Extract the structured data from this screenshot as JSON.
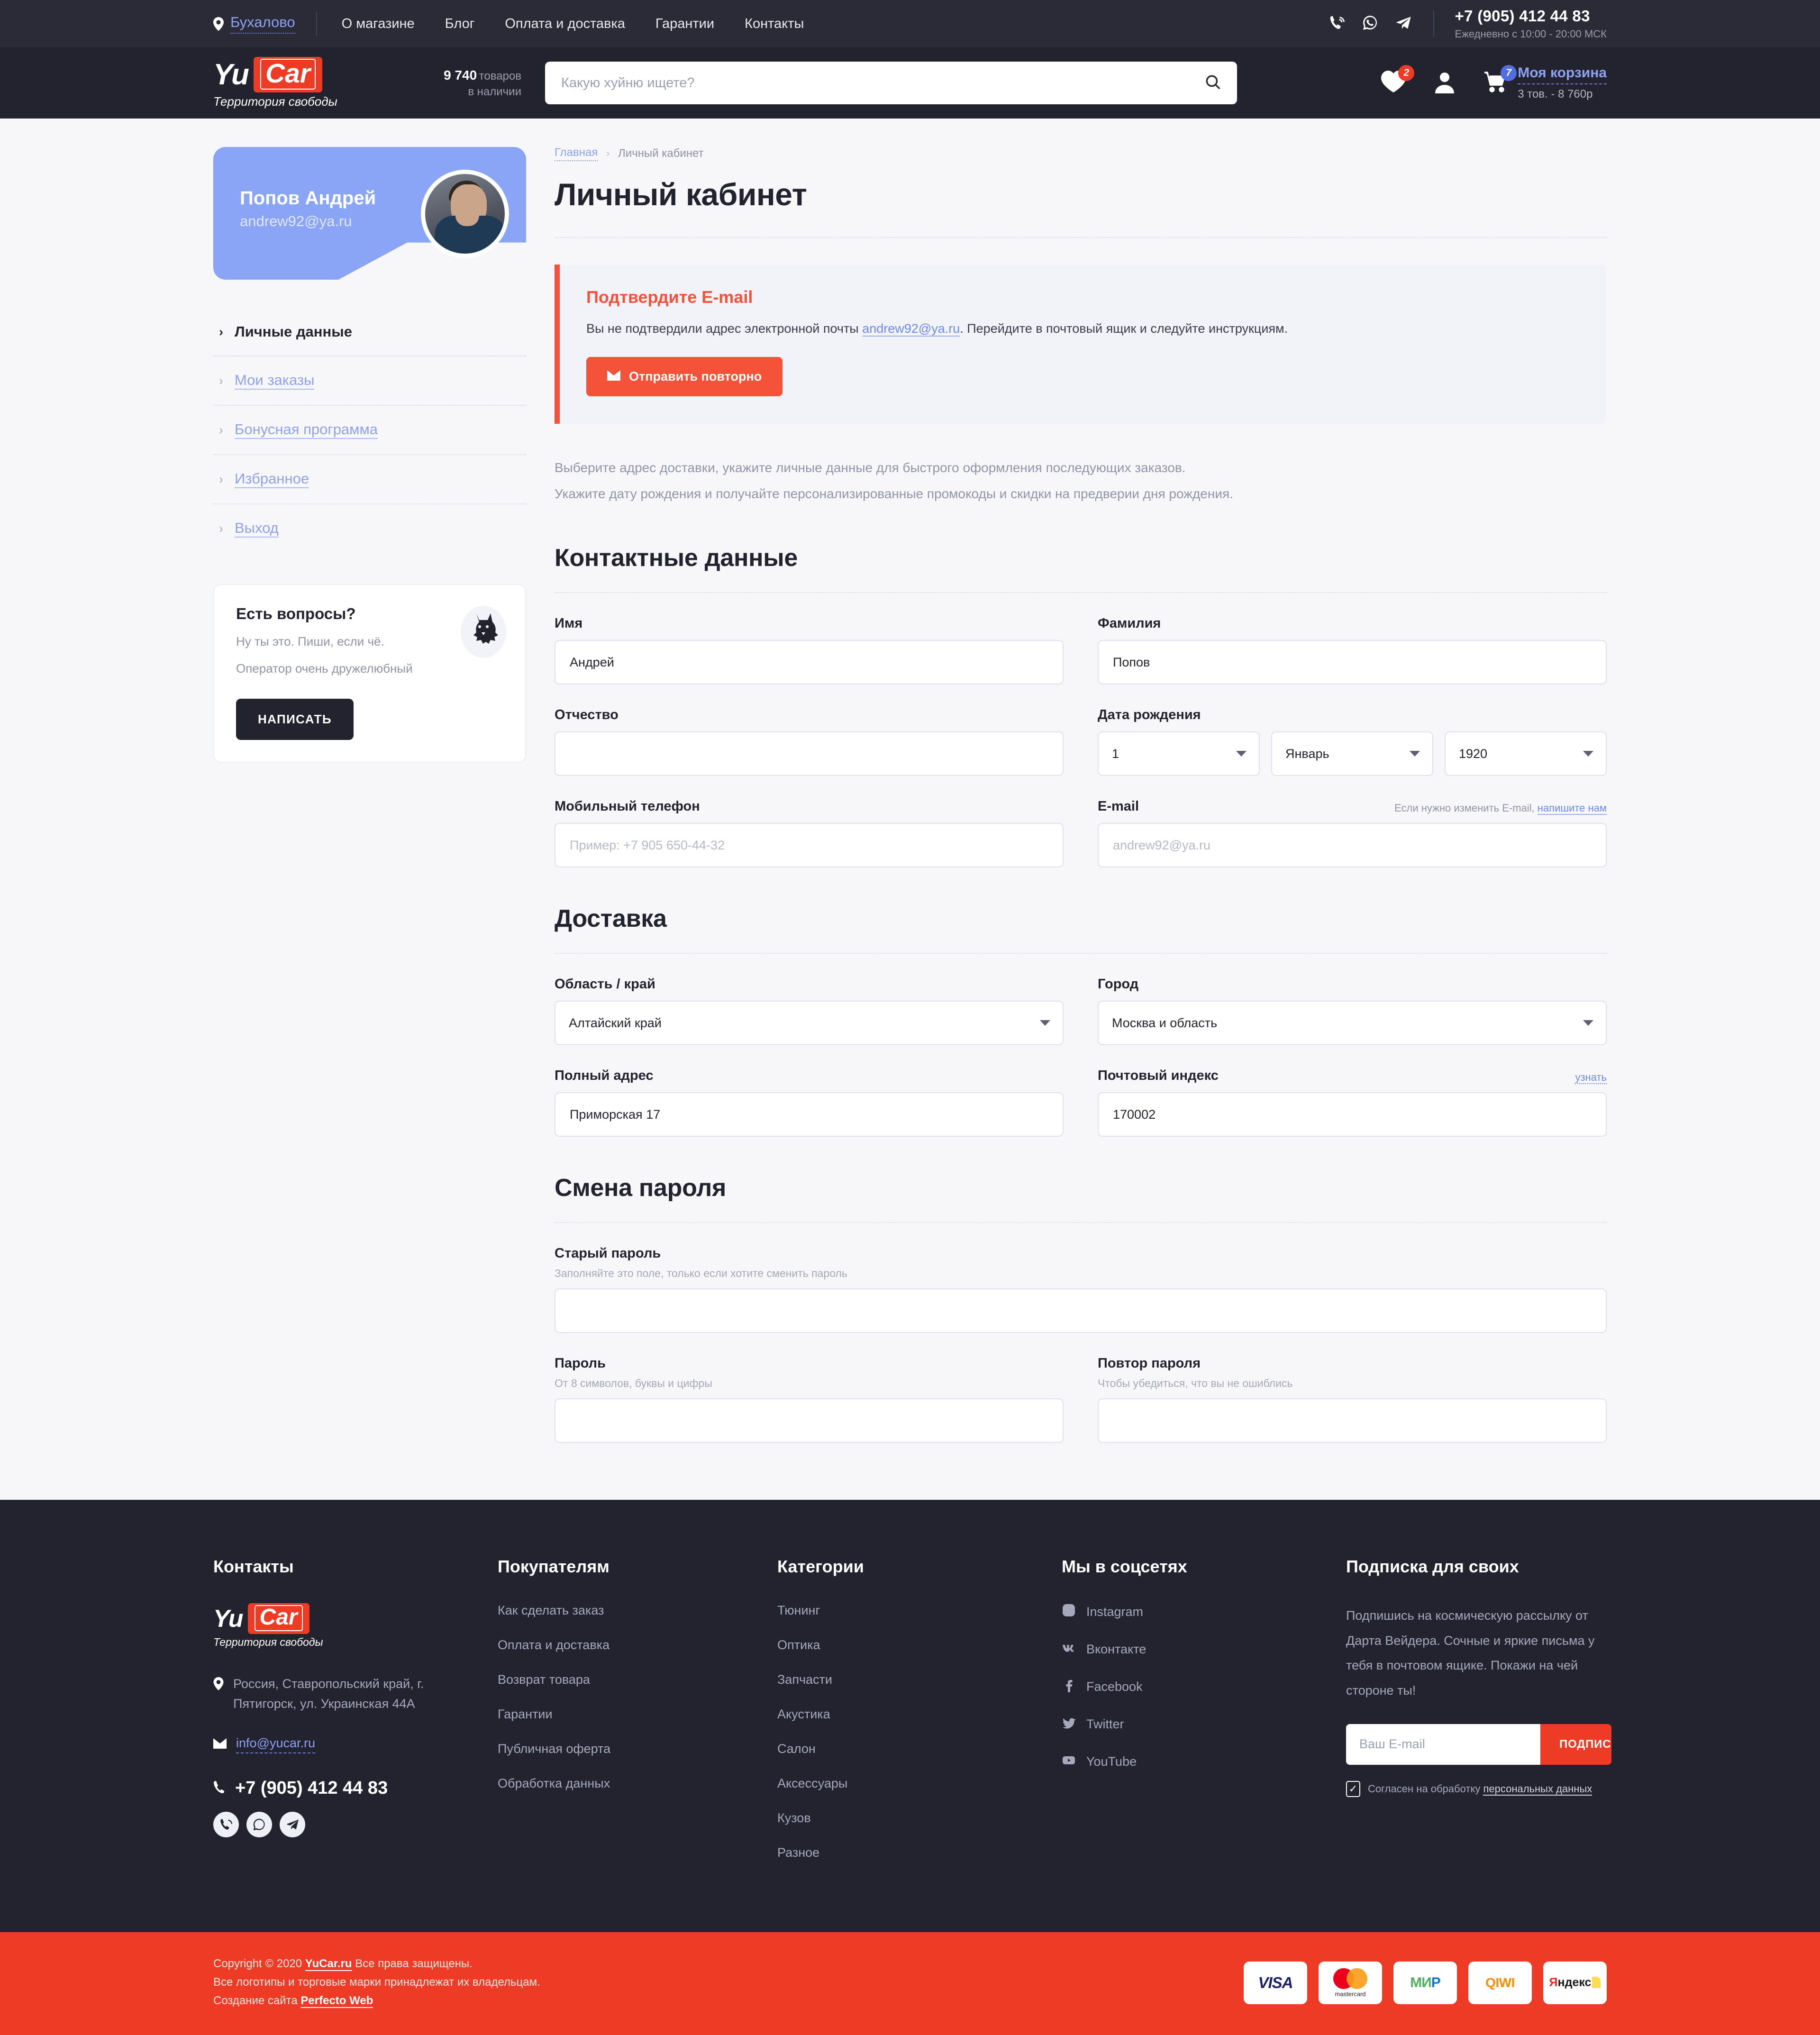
{
  "topbar": {
    "geo_label": "Бухалово",
    "nav": [
      {
        "label": "О магазине"
      },
      {
        "label": "Блог"
      },
      {
        "label": "Оплата и доставка"
      },
      {
        "label": "Гарантии"
      },
      {
        "label": "Контакты"
      }
    ],
    "phone": "+7 (905) 412 44 83",
    "hours": "Ежедневно с 10:00 - 20:00 МСК",
    "icons": [
      "viber-icon",
      "whatsapp-icon",
      "telegram-icon"
    ]
  },
  "header": {
    "logo_yu": "Yu",
    "logo_car": "Car",
    "logo_tagline": "Территория свободы",
    "goods_count": "9 740",
    "goods_word": "товаров",
    "goods_stock": "в наличии",
    "search_placeholder": "Какую хуйню ищете?",
    "search_value": "",
    "favorites_badge": "2",
    "cart_badge": "7",
    "cart_title": "Моя корзина",
    "cart_sub": "3 тов. - 8 760р"
  },
  "sidebar": {
    "profile": {
      "name": "Попов Андрей",
      "email": "andrew92@ya.ru"
    },
    "menu": [
      {
        "label": "Личные данные",
        "active": true
      },
      {
        "label": "Мои заказы",
        "active": false
      },
      {
        "label": "Бонусная программа",
        "active": false
      },
      {
        "label": "Избранное",
        "active": false
      },
      {
        "label": "Выход",
        "active": false
      }
    ],
    "questions": {
      "title": "Есть вопросы?",
      "line1": "Ну ты это. Пиши, если чё.",
      "line2": "Оператор очень дружелюбный",
      "button": "НАПИСАТЬ"
    }
  },
  "main": {
    "breadcrumb_home": "Главная",
    "breadcrumb_current": "Личный кабинет",
    "title": "Личный кабинет",
    "alert": {
      "title": "Подтвердите E-mail",
      "text_before": "Вы не подтвердили адрес электронной почты ",
      "email": "andrew92@ya.ru",
      "text_after": ". Перейдите в почтовый ящик и следуйте инструкциям.",
      "button": "Отправить повторно"
    },
    "lead_1": "Выберите адрес доставки, укажите личные данные для быстрого оформления последующих заказов.",
    "lead_2": "Укажите дату рождения и получайте персонализированные промокоды и скидки на предверии дня рождения.",
    "contacts": {
      "heading": "Контактные данные",
      "first_name_label": "Имя",
      "first_name_value": "Андрей",
      "last_name_label": "Фамилия",
      "last_name_value": "Попов",
      "patronymic_label": "Отчество",
      "patronymic_value": "",
      "dob_label": "Дата рождения",
      "dob_day": "1",
      "dob_month": "Январь",
      "dob_year": "1920",
      "phone_label": "Мобильный телефон",
      "phone_placeholder": "Пример: +7 905 650-44-32",
      "phone_value": "",
      "email_label": "E-mail",
      "email_note": "Если нужно изменить E-mail, ",
      "email_note_link": "напишите нам",
      "email_placeholder": "andrew92@ya.ru",
      "email_value": ""
    },
    "delivery": {
      "heading": "Доставка",
      "region_label": "Область / край",
      "region_value": "Алтайский край",
      "city_label": "Город",
      "city_value": "Москва и область",
      "address_label": "Полный адрес",
      "address_value": "Приморская 17",
      "zip_label": "Почтовый индекс",
      "zip_link": "узнать",
      "zip_value": "170002"
    },
    "password": {
      "heading": "Смена пароля",
      "old_label": "Старый пароль",
      "old_hint": "Заполняйте это поле, только если хотите сменить пароль",
      "old_value": "",
      "new_label": "Пароль",
      "new_hint": "От 8 символов, буквы и цифры",
      "new_value": "",
      "repeat_label": "Повтор пароля",
      "repeat_hint": "Чтобы убедиться, что вы не ошиблись",
      "repeat_value": ""
    }
  },
  "footer": {
    "contacts_heading": "Контакты",
    "logo_yu": "Yu",
    "logo_car": "Car",
    "logo_tagline": "Территория свободы",
    "address": "Россия, Ставропольский край, г. Пятигорск, ул. Украинская 44А",
    "email": "info@yucar.ru",
    "phone": "+7 (905) 412 44 83",
    "buyers_heading": "Покупателям",
    "buyers": [
      {
        "label": "Как сделать заказ"
      },
      {
        "label": "Оплата и доставка"
      },
      {
        "label": "Возврат товара"
      },
      {
        "label": "Гарантии"
      },
      {
        "label": "Публичная оферта"
      },
      {
        "label": "Обработка данных"
      }
    ],
    "categories_heading": "Категории",
    "categories": [
      {
        "label": "Тюнинг"
      },
      {
        "label": "Оптика"
      },
      {
        "label": "Запчасти"
      },
      {
        "label": "Акустика"
      },
      {
        "label": "Салон"
      },
      {
        "label": "Аксессуары"
      },
      {
        "label": "Кузов"
      },
      {
        "label": "Разное"
      }
    ],
    "social_heading": "Мы в соцсетях",
    "socials": [
      {
        "label": "Instagram",
        "icon": "instagram-icon"
      },
      {
        "label": "Вконтакте",
        "icon": "vk-icon"
      },
      {
        "label": "Facebook",
        "icon": "facebook-icon"
      },
      {
        "label": "Twitter",
        "icon": "twitter-icon"
      },
      {
        "label": "YouTube",
        "icon": "youtube-icon"
      }
    ],
    "subscribe_heading": "Подписка для своих",
    "subscribe_text": "Подпишись на космическую рассылку от Дарта Вейдера. Сочные и яркие письма у тебя в почтовом ящике. Покажи на чей стороне ты!",
    "subscribe_placeholder": "Ваш E-mail",
    "subscribe_value": "",
    "subscribe_button": "ПОДПИСАТЬСЯ",
    "agree_text": "Согласен на обработку ",
    "agree_link": "персональных данных",
    "copyright_line1_a": "Copyright © 2020 ",
    "copyright_line1_link": "YuCar.ru",
    "copyright_line1_b": " Все права защищены.",
    "copyright_line2": "Все логотипы и торговые марки принадлежат их владельцам.",
    "copyright_line3_a": "Создание сайта ",
    "copyright_line3_link": "Perfecto Web",
    "payments": [
      "VISA",
      "mastercard",
      "МИР",
      "QIWI",
      "Яндекс"
    ]
  },
  "colors": {
    "accent_red": "#ee3b25",
    "alert_red": "#f4533a",
    "link_blue": "#8da2f0",
    "dark": "#23232f",
    "profile_blue": "#8aa5f6"
  }
}
